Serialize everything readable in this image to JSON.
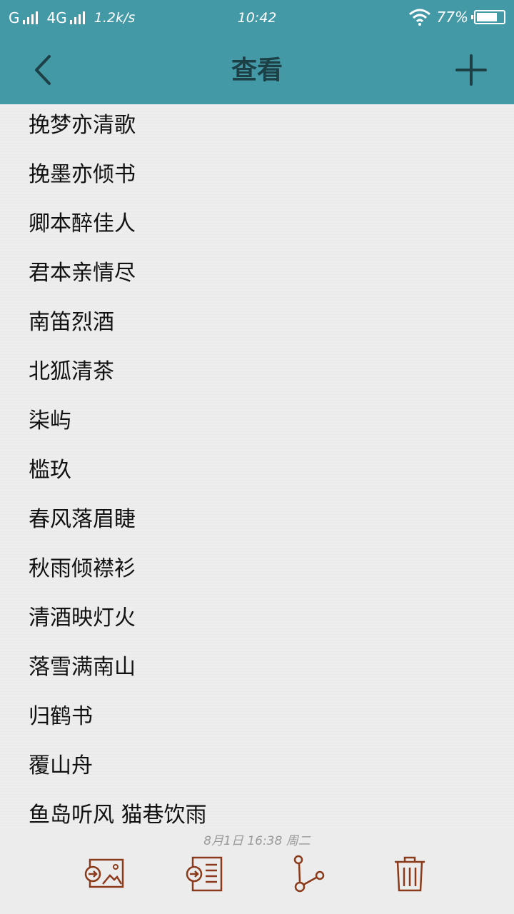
{
  "status_bar": {
    "carrier1": "G",
    "carrier2": "4G",
    "speed": "1.2k/s",
    "time": "10:42",
    "battery_text": "77%",
    "battery_level": 0.77
  },
  "header": {
    "title": "查看",
    "back_icon": "chevron-left-icon",
    "add_icon": "plus-icon"
  },
  "note": {
    "lines": [
      "挽梦亦清歌",
      "挽墨亦倾书",
      "卿本醉佳人",
      "君本亲情尽",
      "南笛烈酒",
      "北狐清茶",
      "柒屿",
      "槛玖",
      "春风落眉睫",
      "秋雨倾襟衫",
      "清酒映灯火",
      "落雪满南山",
      "归鹤书",
      "覆山舟",
      "鱼岛听风 猫巷饮雨"
    ],
    "timestamp": "8月1日 16:38 周二"
  },
  "toolbar": {
    "icons": [
      "export-image-icon",
      "export-text-icon",
      "share-icon",
      "trash-icon"
    ]
  },
  "colors": {
    "header_bg": "#4499a7",
    "title": "#1d3f46",
    "toolbar_icon": "#8b3a1a"
  }
}
